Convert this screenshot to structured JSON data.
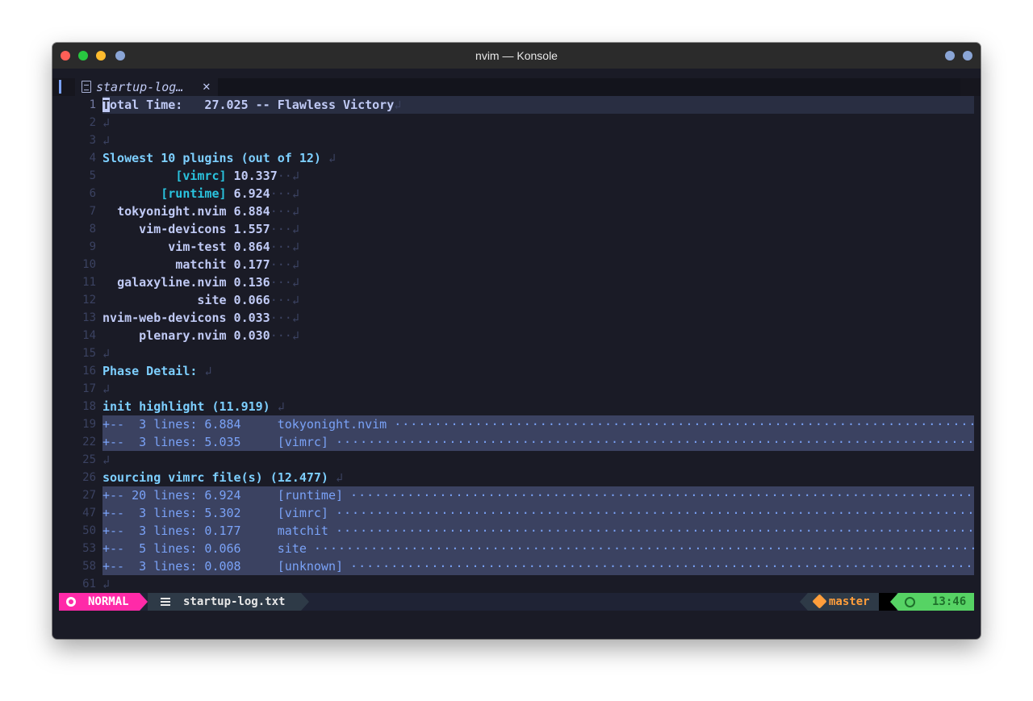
{
  "window": {
    "title": "nvim — Konsole",
    "traffic_lights": [
      "#ff5f57",
      "#28c840",
      "#febc2e",
      "#8aa5d6"
    ],
    "right_buttons": [
      "#8aa5d6",
      "#8aa5d6"
    ]
  },
  "tab": {
    "title": "startup-log…",
    "close_icon": "✕"
  },
  "lines": [
    {
      "n": "1",
      "text": "otal Time:   27.025 -- Flawless Victory",
      "cursor_char": "T",
      "eol": "↲",
      "kind": "cursor"
    },
    {
      "n": "2",
      "text": "",
      "eol": "↲",
      "kind": "plain"
    },
    {
      "n": "3",
      "text": "",
      "eol": "↲",
      "kind": "plain"
    },
    {
      "n": "4",
      "text": "Slowest 10 plugins (out of 12) ",
      "eol": "↲",
      "kind": "section"
    },
    {
      "n": "5",
      "pad": "          ",
      "name": "[vimrc]",
      "value": " 10.337",
      "trail": "··",
      "eol": "↲",
      "kind": "plugin-br"
    },
    {
      "n": "6",
      "pad": "        ",
      "name": "[runtime]",
      "value": " 6.924",
      "trail": "···",
      "eol": "↲",
      "kind": "plugin-br"
    },
    {
      "n": "7",
      "pad": "  ",
      "name": "tokyonight.nvim",
      "value": " 6.884",
      "trail": "···",
      "eol": "↲",
      "kind": "plugin"
    },
    {
      "n": "8",
      "pad": "     ",
      "name": "vim-devicons",
      "value": " 1.557",
      "trail": "···",
      "eol": "↲",
      "kind": "plugin"
    },
    {
      "n": "9",
      "pad": "         ",
      "name": "vim-test",
      "value": " 0.864",
      "trail": "···",
      "eol": "↲",
      "kind": "plugin"
    },
    {
      "n": "10",
      "pad": "          ",
      "name": "matchit",
      "value": " 0.177",
      "trail": "···",
      "eol": "↲",
      "kind": "plugin"
    },
    {
      "n": "11",
      "pad": "  ",
      "name": "galaxyline.nvim",
      "value": " 0.136",
      "trail": "···",
      "eol": "↲",
      "kind": "plugin"
    },
    {
      "n": "12",
      "pad": "             ",
      "name": "site",
      "value": " 0.066",
      "trail": "···",
      "eol": "↲",
      "kind": "plugin"
    },
    {
      "n": "13",
      "pad": "",
      "name": "nvim-web-devicons",
      "value": " 0.033",
      "trail": "···",
      "eol": "↲",
      "kind": "plugin"
    },
    {
      "n": "14",
      "pad": "     ",
      "name": "plenary.nvim",
      "value": " 0.030",
      "trail": "···",
      "eol": "↲",
      "kind": "plugin"
    },
    {
      "n": "15",
      "text": "",
      "eol": "↲",
      "kind": "plain"
    },
    {
      "n": "16",
      "text": "Phase Detail: ",
      "eol": "↲",
      "kind": "section"
    },
    {
      "n": "17",
      "text": "",
      "eol": "↲",
      "kind": "plain"
    },
    {
      "n": "18",
      "text": "init highlight (11.919) ",
      "eol": "↲",
      "kind": "section"
    },
    {
      "n": "19",
      "text": "+--  3 lines: 6.884     tokyonight.nvim ",
      "kind": "fold"
    },
    {
      "n": "22",
      "text": "+--  3 lines: 5.035     [vimrc] ",
      "kind": "fold"
    },
    {
      "n": "25",
      "text": "",
      "eol": "↲",
      "kind": "plain"
    },
    {
      "n": "26",
      "text": "sourcing vimrc file(s) (12.477) ",
      "eol": "↲",
      "kind": "section"
    },
    {
      "n": "27",
      "text": "+-- 20 lines: 6.924     [runtime] ",
      "kind": "fold"
    },
    {
      "n": "47",
      "text": "+--  3 lines: 5.302     [vimrc] ",
      "kind": "fold"
    },
    {
      "n": "50",
      "text": "+--  3 lines: 0.177     matchit ",
      "kind": "fold"
    },
    {
      "n": "53",
      "text": "+--  5 lines: 0.066     site ",
      "kind": "fold"
    },
    {
      "n": "58",
      "text": "+--  3 lines: 0.008     [unknown] ",
      "kind": "fold"
    },
    {
      "n": "61",
      "text": "",
      "eol": "↲",
      "kind": "plain"
    }
  ],
  "statusline": {
    "mode": "NORMAL",
    "filename": "startup-log.txt",
    "branch": "master",
    "time": "13:46"
  }
}
